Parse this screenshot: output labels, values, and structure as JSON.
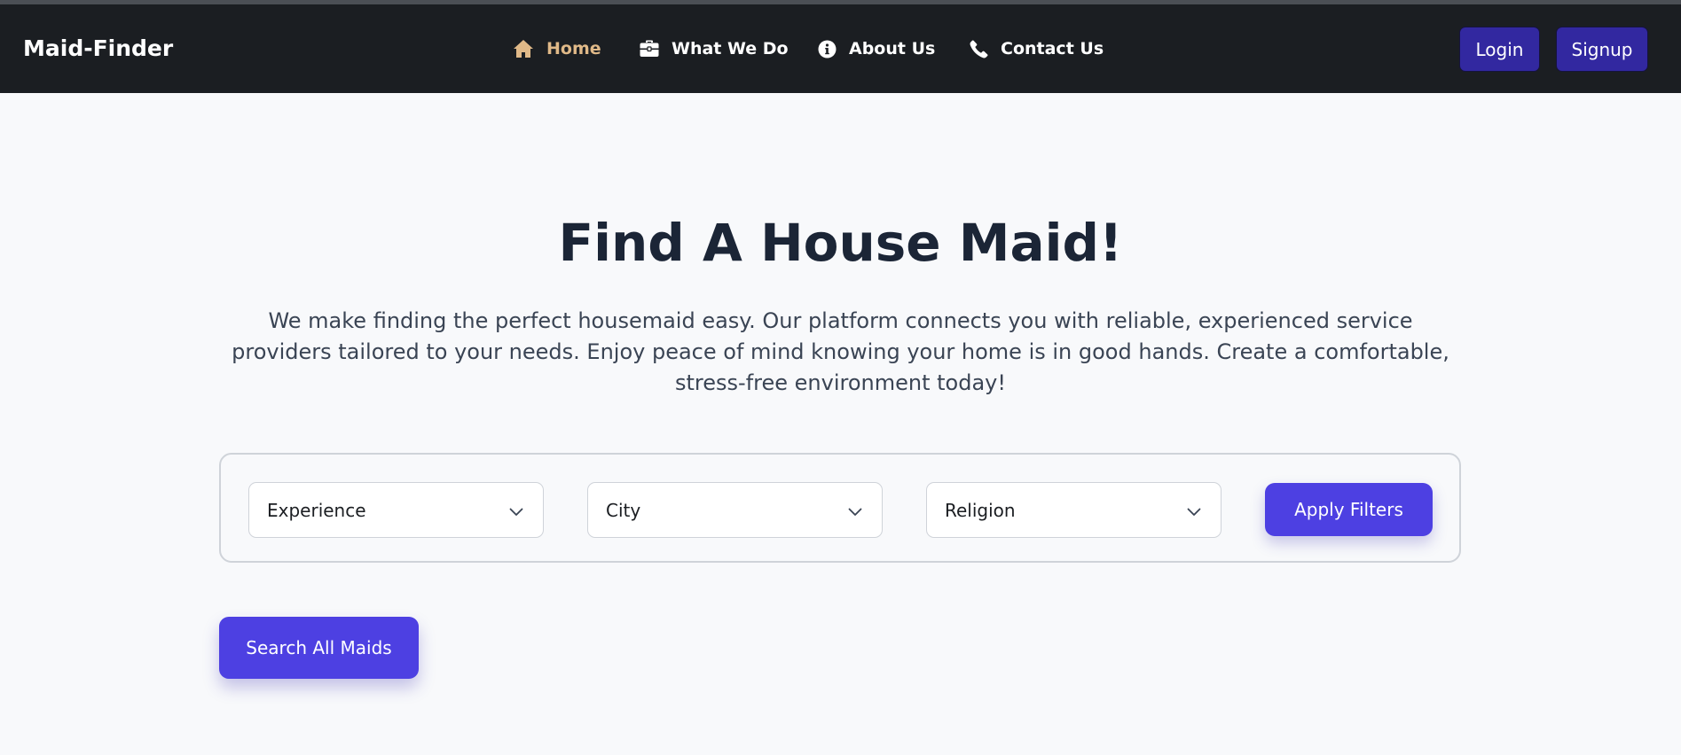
{
  "navbar": {
    "brand": "Maid-Finder",
    "links": [
      {
        "label": "Home",
        "icon": "home-icon",
        "active": true
      },
      {
        "label": "What We Do",
        "icon": "briefcase-icon",
        "active": false
      },
      {
        "label": "About Us",
        "icon": "info-circle-icon",
        "active": false
      },
      {
        "label": "Contact Us",
        "icon": "phone-icon",
        "active": false
      }
    ],
    "login_label": "Login",
    "signup_label": "Signup"
  },
  "hero": {
    "title": "Find A House Maid!",
    "description": "We make finding the perfect housemaid easy. Our platform connects you with reliable, experienced service providers tailored to your needs. Enjoy peace of mind knowing your home is in good hands. Create a comfortable, stress-free environment today!"
  },
  "filters": {
    "experience": "Experience",
    "city": "City",
    "religion": "Religion",
    "apply_label": "Apply Filters"
  },
  "search_all_label": "Search All Maids",
  "colors": {
    "navbar_bg": "#1b1e22",
    "active_link": "#e0b988",
    "primary": "#4d40e2",
    "auth_button": "#3228a0",
    "page_bg": "#f8f9fb",
    "title": "#1b2536"
  }
}
